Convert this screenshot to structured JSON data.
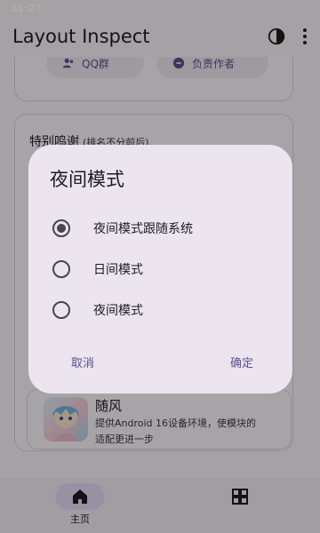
{
  "status_bar": {
    "time": "11:27"
  },
  "app_bar": {
    "title": "Layout Inspect",
    "contrast_icon": "contrast-icon",
    "more_icon": "more-vert-icon"
  },
  "top_card": {
    "chips": [
      {
        "label": "QQ群",
        "icon": "people-icon"
      },
      {
        "label": "负责作者",
        "icon": "link-icon"
      }
    ]
  },
  "thanks_card": {
    "title": "特别鸣谢",
    "subtitle": "(排名不分前后)"
  },
  "contributor": {
    "name": "随风",
    "description_line1": "提供Android 16设备环境，使模块的",
    "description_line2": "适配更进一步"
  },
  "bottom_nav": {
    "items": [
      {
        "label": "主页",
        "icon": "home-icon",
        "active": true
      },
      {
        "label": "",
        "icon": "grid-icon",
        "active": false
      }
    ]
  },
  "dialog": {
    "title": "夜间模式",
    "options": [
      {
        "label": "夜间模式跟随系统",
        "selected": true
      },
      {
        "label": "日间模式",
        "selected": false
      },
      {
        "label": "夜间模式",
        "selected": false
      }
    ],
    "cancel_label": "取消",
    "confirm_label": "确定"
  },
  "colors": {
    "accent": "#5d4f8c",
    "surface": "#f3eef4",
    "dialog_surface": "#ece5f0",
    "scrim": "rgba(0,0,0,0.32)"
  }
}
